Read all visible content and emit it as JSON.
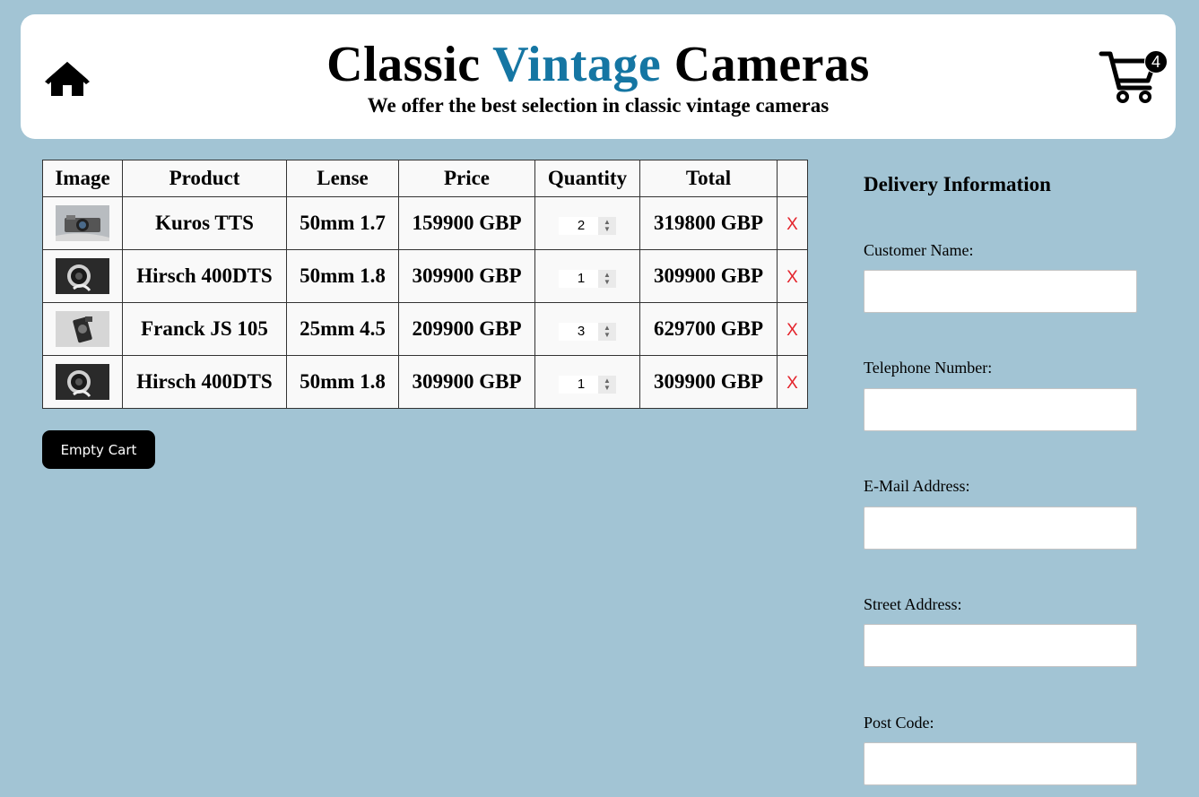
{
  "header": {
    "title_part1": "Classic ",
    "title_accent": "Vintage",
    "title_part2": " Cameras",
    "subtitle": "We offer the best selection in classic vintage cameras",
    "home_icon": "home-icon",
    "cart_icon": "cart-icon",
    "cart_count": "4",
    "accent_color": "#1576a3"
  },
  "table": {
    "headers": [
      "Image",
      "Product",
      "Lense",
      "Price",
      "Quantity",
      "Total",
      ""
    ],
    "rows": [
      {
        "product": "Kuros TTS",
        "lense": "50mm 1.7",
        "price": "159900 GBP",
        "quantity": "2",
        "total": "319800 GBP",
        "remove": "X"
      },
      {
        "product": "Hirsch 400DTS",
        "lense": "50mm 1.8",
        "price": "309900 GBP",
        "quantity": "1",
        "total": "309900 GBP",
        "remove": "X"
      },
      {
        "product": "Franck JS 105",
        "lense": "25mm 4.5",
        "price": "209900 GBP",
        "quantity": "3",
        "total": "629700 GBP",
        "remove": "X"
      },
      {
        "product": "Hirsch 400DTS",
        "lense": "50mm 1.8",
        "price": "309900 GBP",
        "quantity": "1",
        "total": "309900 GBP",
        "remove": "X"
      }
    ]
  },
  "empty_cart_label": "Empty Cart",
  "delivery": {
    "heading": "Delivery Information",
    "fields": [
      {
        "label": "Customer Name:",
        "value": ""
      },
      {
        "label": "Telephone Number:",
        "value": ""
      },
      {
        "label": "E-Mail Address:",
        "value": ""
      },
      {
        "label": "Street Address:",
        "value": ""
      },
      {
        "label": "Post Code:",
        "value": ""
      }
    ]
  },
  "colors": {
    "page_background": "#a2c4d4",
    "remove_red": "#e4232b",
    "button_black": "#000000"
  }
}
